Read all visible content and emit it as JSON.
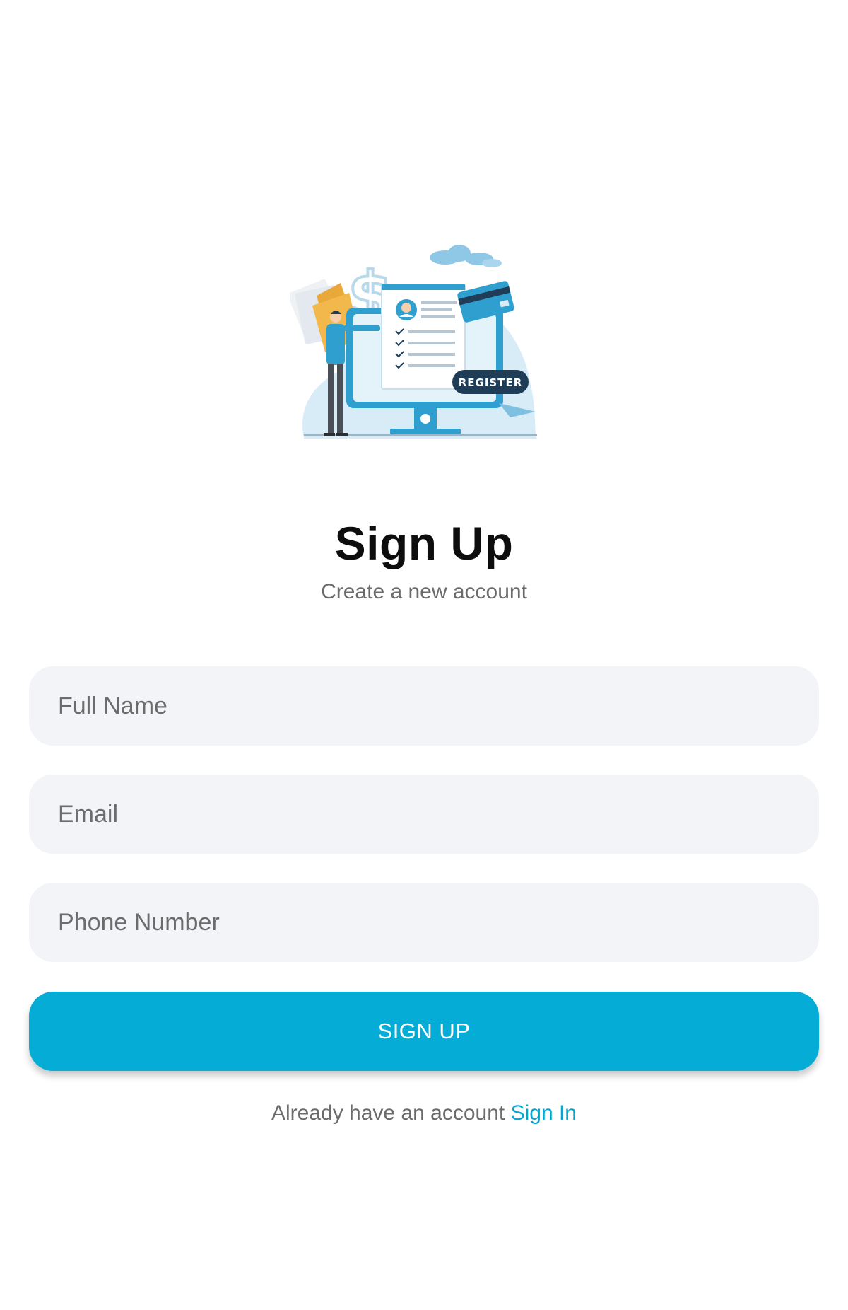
{
  "illustration": {
    "name": "register-illustration",
    "badge_text": "REGISTER",
    "colors": {
      "primary": "#2f9fcf",
      "light": "#d8ecf7",
      "dark": "#1f3d57",
      "folder": "#f2b84b"
    }
  },
  "header": {
    "title": "Sign Up",
    "subtitle": "Create a new account"
  },
  "form": {
    "full_name": {
      "placeholder": "Full Name",
      "value": ""
    },
    "email": {
      "placeholder": "Email",
      "value": ""
    },
    "phone": {
      "placeholder": "Phone Number",
      "value": ""
    },
    "submit_label": "SIGN UP"
  },
  "footer": {
    "prompt": "Already have an account",
    "link_label": "Sign In"
  },
  "colors": {
    "accent": "#05add6",
    "link": "#05a5cf",
    "field_bg": "#f3f4f8",
    "background": "#ffffff"
  }
}
